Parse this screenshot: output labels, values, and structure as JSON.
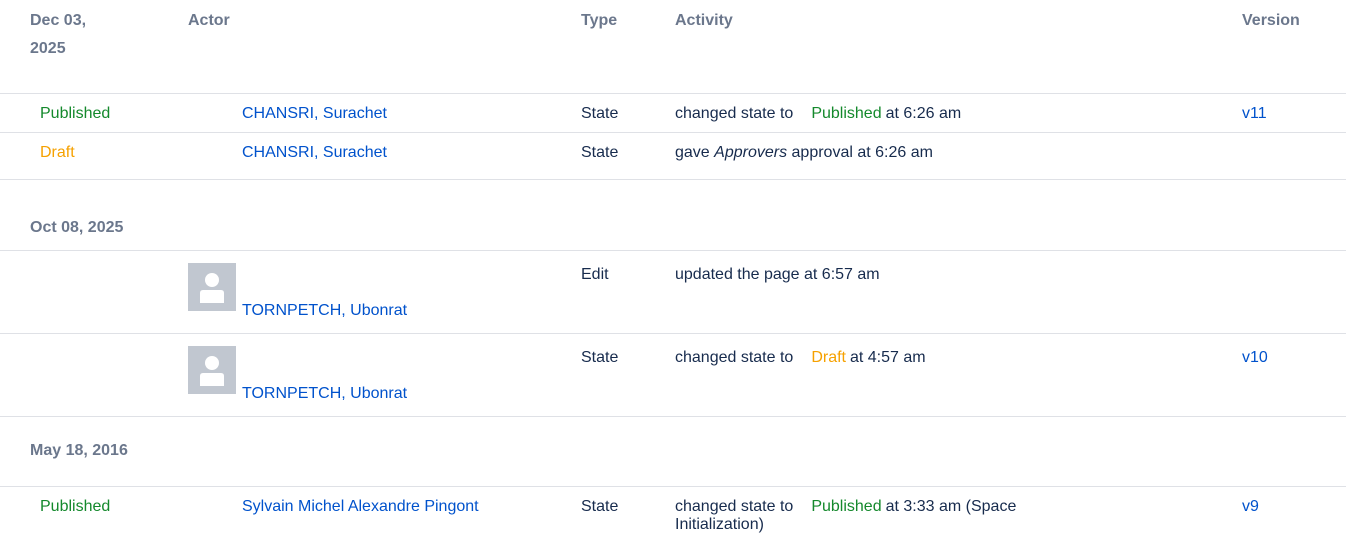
{
  "header": {
    "date_line1": "Dec 03,",
    "date_line2": "2025",
    "actor": "Actor",
    "type": "Type",
    "activity": "Activity",
    "version": "Version"
  },
  "groups": [
    {
      "rows": [
        {
          "state": "Published",
          "actor": "CHANSRI, Surachet",
          "type": "State",
          "activity_prefix": "changed state to",
          "activity_state": "Published",
          "activity_suffix": "at 6:26 am",
          "version": "v11"
        },
        {
          "state": "Draft",
          "actor": "CHANSRI, Surachet",
          "type": "State",
          "activity_prefix": "gave",
          "activity_italic": "Approvers",
          "activity_suffix": "approval at 6:26 am",
          "version": ""
        }
      ]
    },
    {
      "date": "Oct 08, 2025",
      "rows": [
        {
          "actor": "TORNPETCH, Ubonrat",
          "type": "Edit",
          "activity": "updated the page at 6:57 am",
          "version": ""
        },
        {
          "actor": "TORNPETCH, Ubonrat",
          "type": "State",
          "activity_prefix": "changed state to",
          "activity_state": "Draft",
          "activity_suffix": "at 4:57 am",
          "version": "v10"
        }
      ]
    },
    {
      "date": "May 18, 2016",
      "rows": [
        {
          "state": "Published",
          "actor": "Sylvain Michel Alexandre Pingont",
          "type": "State",
          "activity_prefix": "changed state to",
          "activity_state": "Published",
          "activity_suffix": "at 3:33 am (Space",
          "activity_line2": "Initialization)",
          "version": "v9"
        }
      ]
    }
  ],
  "icons": {
    "avatar": "default-user-avatar-icon"
  },
  "colors": {
    "published": "#14892c",
    "draft": "#f6a100",
    "link": "#0052cc",
    "header": "#6b778c"
  }
}
